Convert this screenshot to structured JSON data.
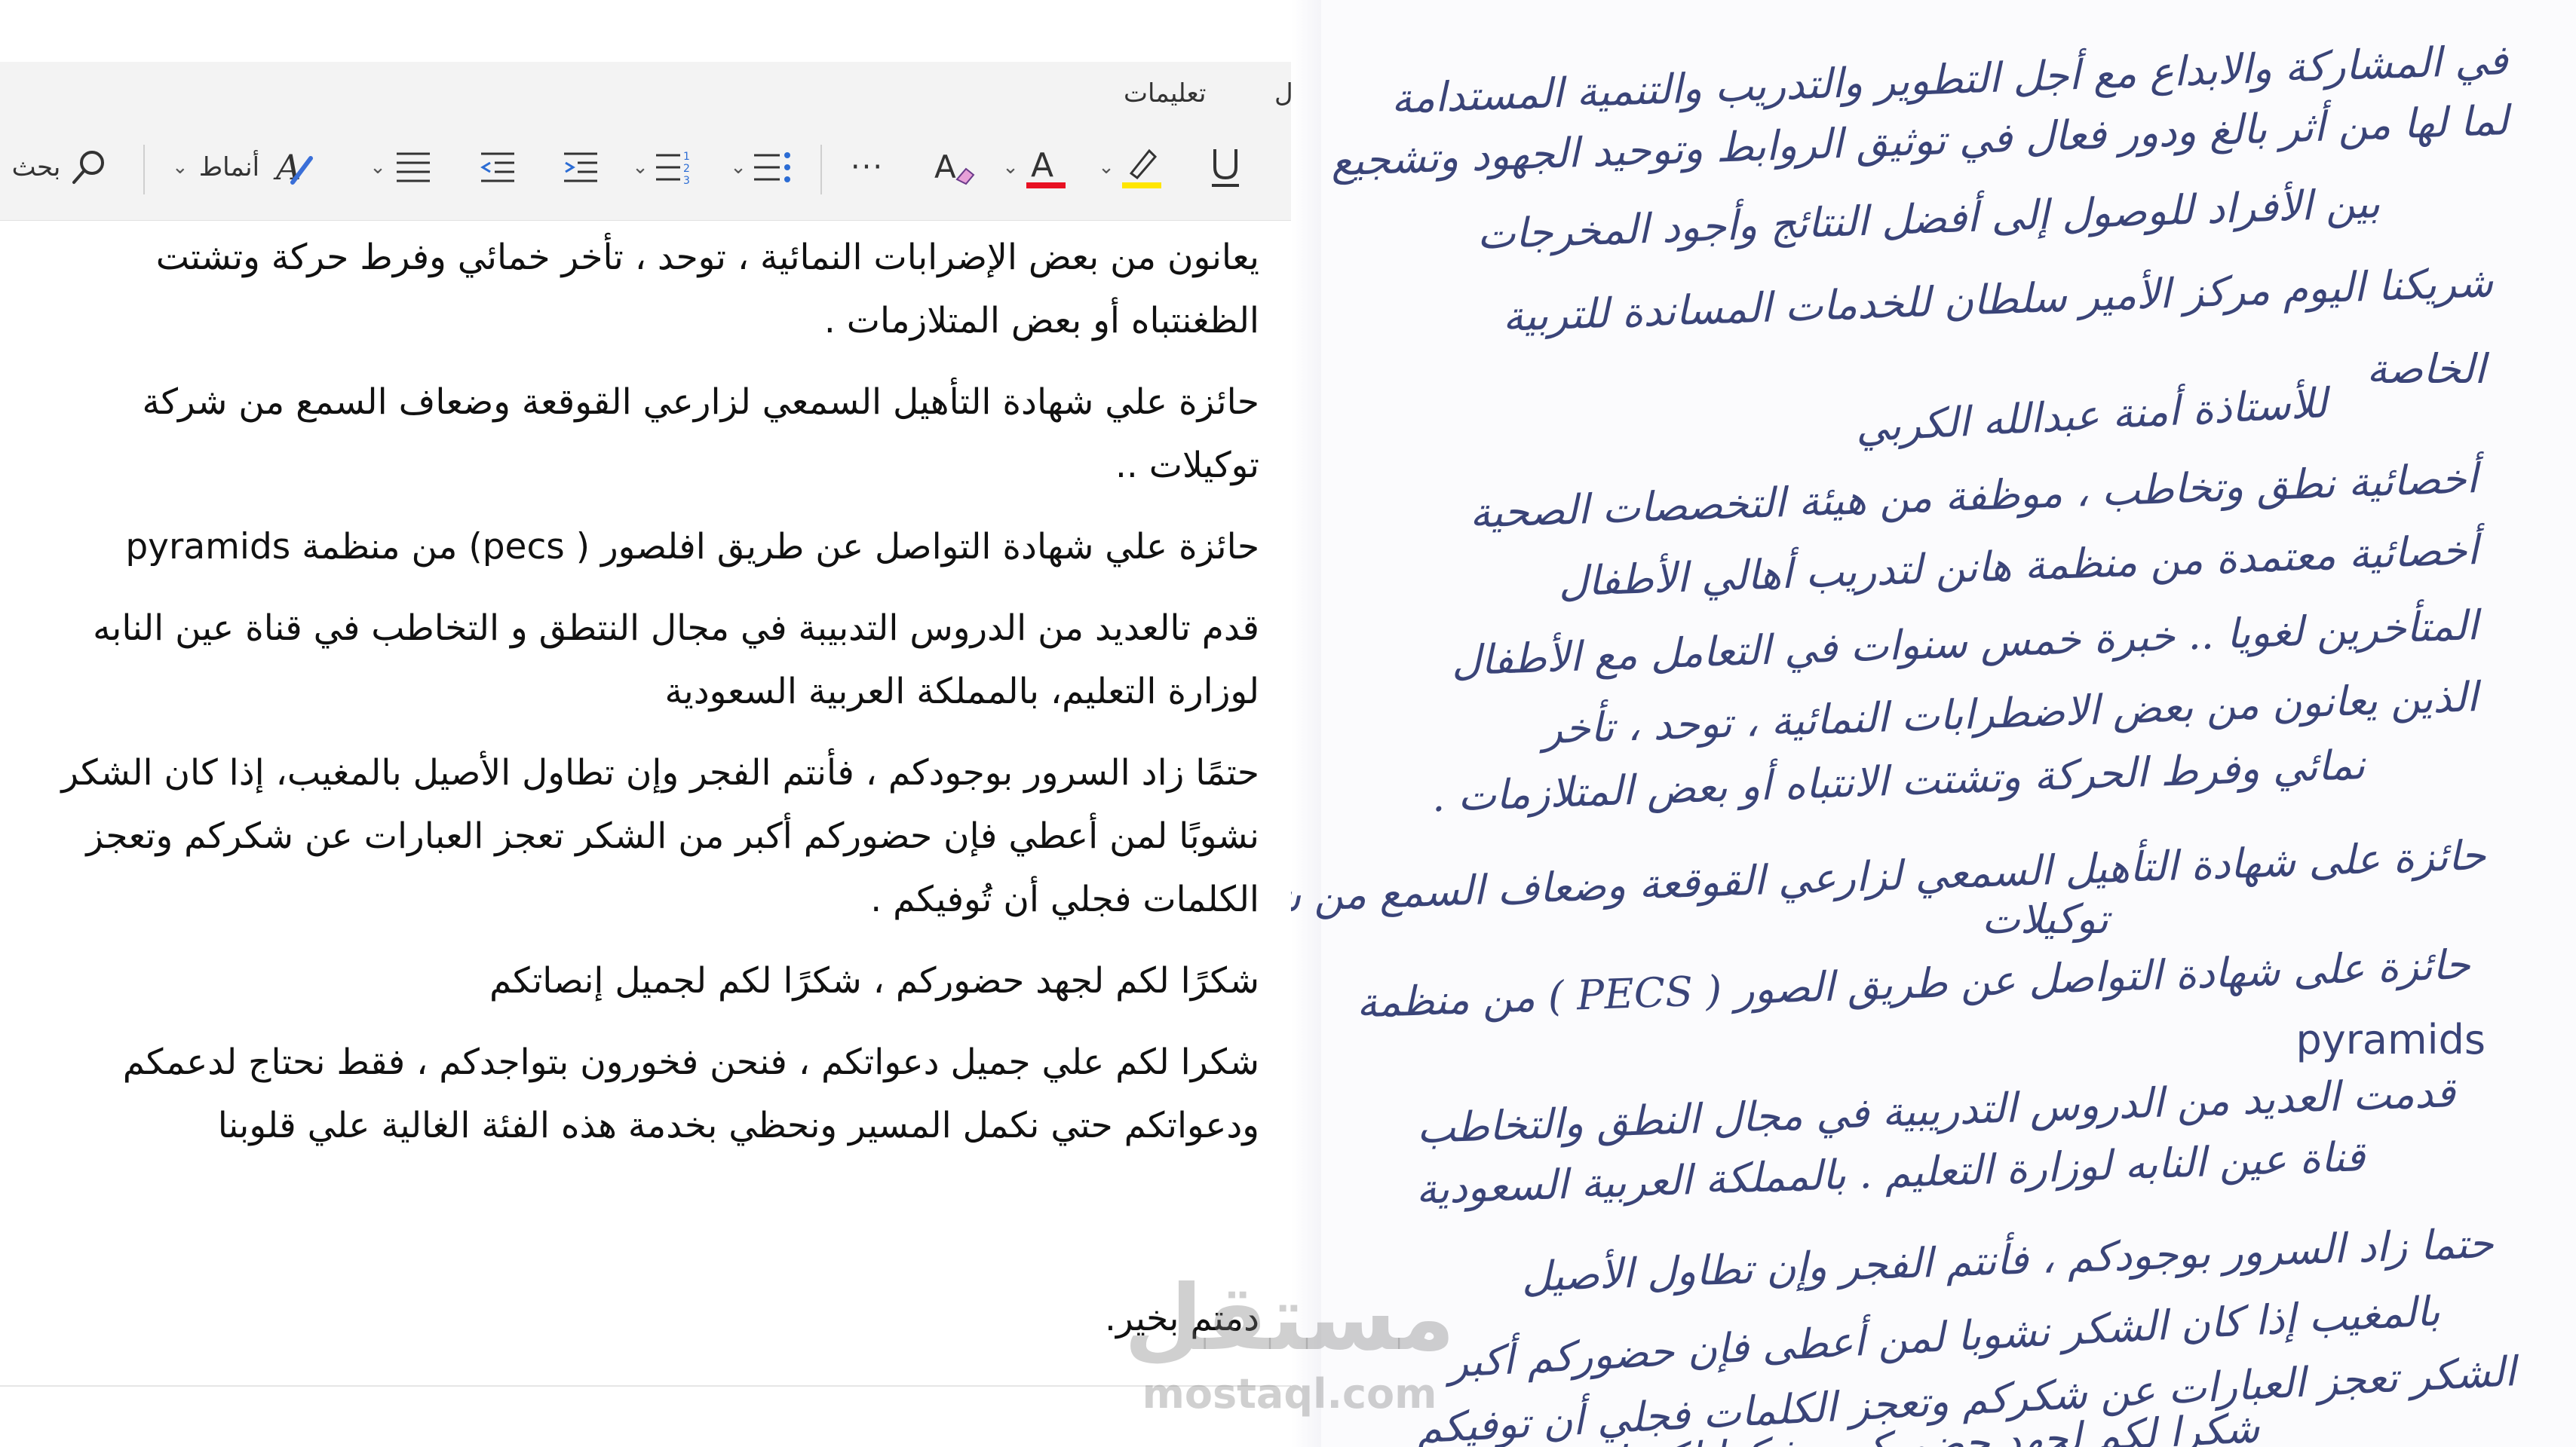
{
  "ribbon": {
    "tab_help": "تعليمات",
    "tab_partial": "ل",
    "search_label": "بحث",
    "styles_label": "أنماط",
    "more": "···",
    "icons": [
      "search-icon",
      "styles-icon",
      "line-spacing-icon",
      "decrease-indent-icon",
      "increase-indent-icon",
      "numbered-list-icon",
      "bullet-list-icon",
      "more-options-icon",
      "clear-formatting-icon",
      "font-color-icon",
      "highlighter-icon",
      "underline-icon"
    ],
    "colors": {
      "font_color": "#e81123",
      "highlight": "#ffe600"
    }
  },
  "document": {
    "paragraphs": [
      "يعانون من بعض الإضرابات النمائية ، توحد ، تأخر خمائي وفرط حركة وتشتت الظغنتباه أو بعض المتلازمات .",
      "حائزة علي شهادة التأهيل السمعي لزارعي القوقعة وضعاف السمع من شركة توكيلات ..",
      "حائزة علي شهادة التواصل عن طريق افلصور ( pecs) من منظمة pyramids",
      "قدم تالعديد من الدروس التدبيبة في مجال النتطق و التخاطب في قناة عين النابه لوزارة التعليم، بالمملكة العربية السعودية",
      "حتمًا زاد السرور بوجودكم ، فأنتم الفجر وإن تطاول الأصيل بالمغيب، إذا كان الشكر نشوبًا لمن أعطي فإن حضوركم أكبر من الشكر تعجز العبارات عن شكركم وتعجز الكلمات فجلي أن تُوفيكم .",
      "شكرًا لكم لجهد حضوركم ، شكرًا لكم لجميل إنصاتكم",
      "شكرا لكم علي جميل دعواتكم ، فنحن فخورون بتواجدكم ، فقط نحتاج لدعمكم ودعواتكم حتي نكمل المسير ونحظي بخدمة هذه الفئة الغالية علي قلوبنا"
    ],
    "closing": "دمتم بخير."
  },
  "handwriting": {
    "lines": [
      "في المشاركة والابداع مع أجل التطوير والتدريب والتنمية المستدامة",
      "لما لها من أثر بالغ ودور فعال في توثيق الروابط وتوحيد الجهود وتشجيع",
      "بين الأفراد للوصول إلى أفضل النتائج وأجود المخرجات",
      "شريكنا اليوم مركز الأمير سلطان للخدمات المساندة للتربية",
      "الخاصة",
      "للأستاذة أمنة عبدالله الكربي",
      "أخصائية نطق وتخاطب ، موظفة من هيئة التخصصات الصحية",
      "أخصائية معتمدة من منظمة هانن لتدريب أهالي الأطفال",
      "المتأخرين لغويا .. خبرة خمس سنوات في التعامل مع الأطفال",
      "الذين يعانون من بعض الاضطرابات النمائية ، توحد ، تأخر",
      "نمائي وفرط الحركة وتشتت الانتباه أو بعض المتلازمات .",
      "حائزة على شهادة التأهيل السمعي لزارعي القوقعة وضعاف السمع من شركة",
      "توكيلات",
      "حائزة على شهادة التواصل عن طريق الصور ( PECS ) من منظمة",
      "pyramids",
      "قدمت العديد من الدروس التدريبية في مجال النطق والتخاطب",
      "قناة عين النابه لوزارة التعليم . بالمملكة العربية السعودية",
      "حتما زاد السرور بوجودكم ، فأنتم الفجر وإن تطاول الأصيل",
      "بالمغيب إذا كان الشكر نشوبا لمن أعطى فإن حضوركم أكبر",
      "الشكر تعجز العبارات عن شكركم وتعجز الكلمات فجلي أن توفيكم",
      "شكرا لكم لجهد حضوركم ، شكرا لكم لجميل إنصاتكم"
    ]
  },
  "watermark": {
    "arabic": "مستقل",
    "latin": "mostaql.com"
  }
}
